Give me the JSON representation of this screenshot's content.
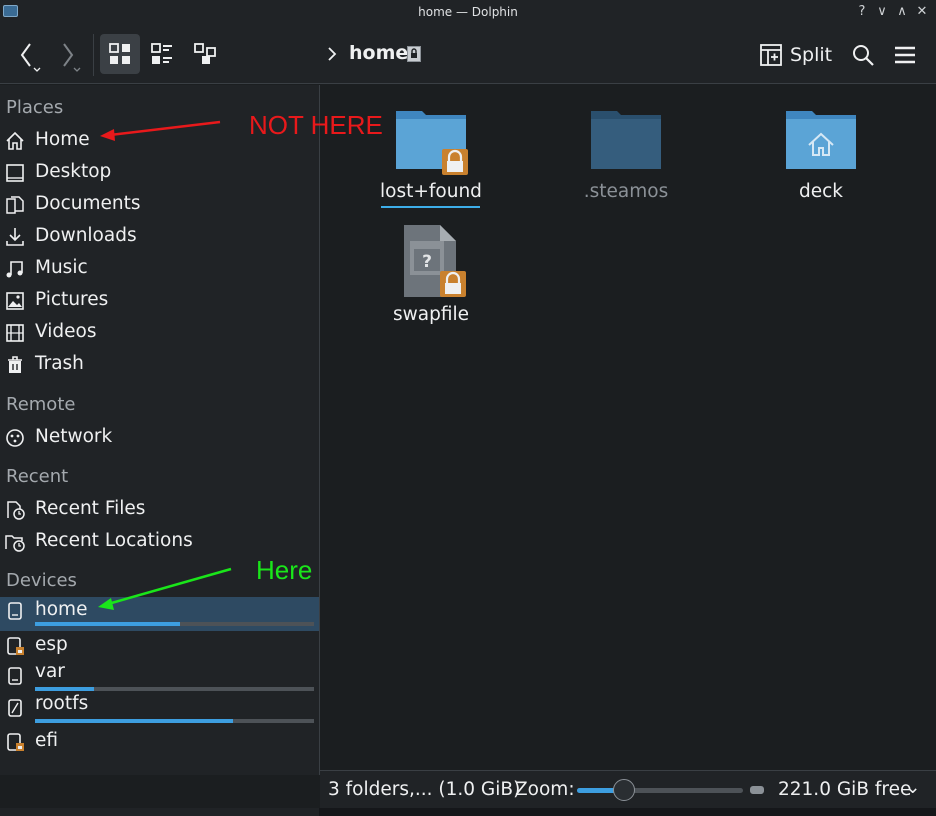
{
  "window": {
    "title": "home — Dolphin",
    "help_glyph": "?",
    "min_glyph": "∨",
    "max_glyph": "∧",
    "close_glyph": "✕"
  },
  "toolbar": {
    "breadcrumb_chevron": "›",
    "breadcrumb_current": "home",
    "split_label": "Split",
    "icons": [
      "back-icon",
      "forward-icon",
      "icons-view-icon",
      "details-view-icon",
      "tree-view-icon",
      "lock-icon",
      "split-icon",
      "search-icon",
      "hamburger-menu-icon"
    ]
  },
  "sidebar": {
    "sections": {
      "places": "Places",
      "remote": "Remote",
      "recent": "Recent",
      "devices": "Devices"
    },
    "places": [
      {
        "label": "Home",
        "icon": "home-icon"
      },
      {
        "label": "Desktop",
        "icon": "desktop-icon"
      },
      {
        "label": "Documents",
        "icon": "documents-icon"
      },
      {
        "label": "Downloads",
        "icon": "downloads-icon"
      },
      {
        "label": "Music",
        "icon": "music-icon"
      },
      {
        "label": "Pictures",
        "icon": "pictures-icon"
      },
      {
        "label": "Videos",
        "icon": "videos-icon"
      },
      {
        "label": "Trash",
        "icon": "trash-icon"
      }
    ],
    "remote": [
      {
        "label": "Network",
        "icon": "network-icon"
      }
    ],
    "recent": [
      {
        "label": "Recent Files",
        "icon": "recent-files-icon"
      },
      {
        "label": "Recent Locations",
        "icon": "recent-locations-icon"
      }
    ],
    "devices": [
      {
        "label": "home",
        "icon": "drive-icon",
        "usage_fraction": 0.52,
        "selected": true
      },
      {
        "label": "esp",
        "icon": "locked-drive-icon"
      },
      {
        "label": "var",
        "icon": "drive-icon",
        "usage_fraction": 0.21
      },
      {
        "label": "rootfs",
        "icon": "rootfs-drive-icon",
        "usage_fraction": 0.71
      },
      {
        "label": "efi",
        "icon": "locked-drive-icon"
      }
    ]
  },
  "files": [
    {
      "name": "lost+found",
      "icon": "locked-folder-icon",
      "focused": true
    },
    {
      "name": ".steamos",
      "icon": "hidden-folder-icon",
      "hidden": true
    },
    {
      "name": "deck",
      "icon": "home-folder-icon"
    },
    {
      "name": "swapfile",
      "icon": "locked-unknown-file-icon"
    }
  ],
  "statusbar": {
    "summary": "3 folders,... (1.0 GiB)",
    "zoom_label": "Zoom:",
    "zoom_fraction": 0.28,
    "free_space": "221.0 GiB free",
    "free_chevron": "⌄"
  },
  "annotations": {
    "not_here": "NOT HERE",
    "here": "Here",
    "not_here_color": "#e8191b",
    "here_color": "#1ae61a"
  },
  "colors": {
    "accent": "#3daee9",
    "background": "#1b1e20",
    "sidebar": "#202326",
    "folder": "#5ba4d6"
  }
}
